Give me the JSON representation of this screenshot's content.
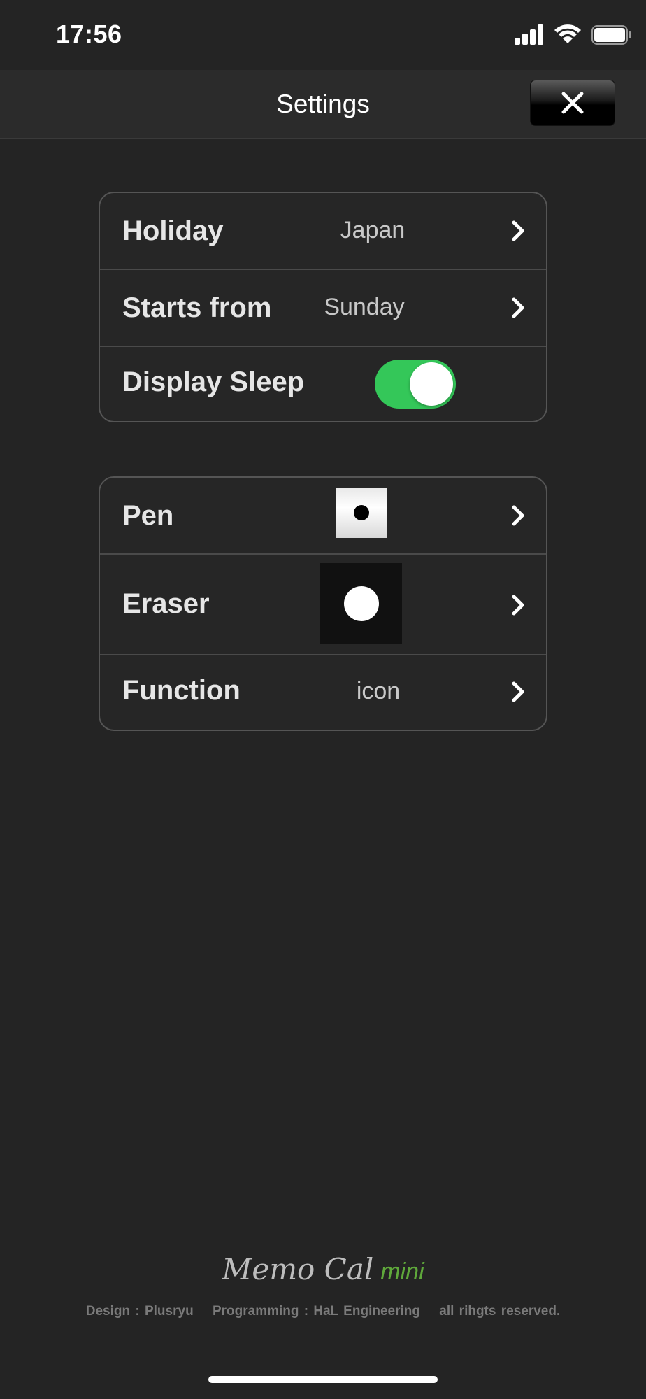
{
  "status_bar": {
    "time": "17:56"
  },
  "header": {
    "title": "Settings",
    "close_icon": "close-x-icon"
  },
  "group1": {
    "holiday": {
      "label": "Holiday",
      "value": "Japan"
    },
    "starts_from": {
      "label": "Starts from",
      "value": "Sunday"
    },
    "display_sleep": {
      "label": "Display Sleep",
      "enabled": true
    }
  },
  "group2": {
    "pen": {
      "label": "Pen"
    },
    "eraser": {
      "label": "Eraser"
    },
    "function": {
      "label": "Function",
      "value": "icon"
    }
  },
  "footer": {
    "logo_main": "Memo Cal",
    "logo_mini": "mini",
    "design": "Design : Plusryu",
    "programming": "Programming : HaL Engineering",
    "rights": "all rihgts reserved."
  },
  "colors": {
    "toggle_on": "#34c759",
    "mini_accent": "#5fa83b",
    "background": "#242424"
  }
}
